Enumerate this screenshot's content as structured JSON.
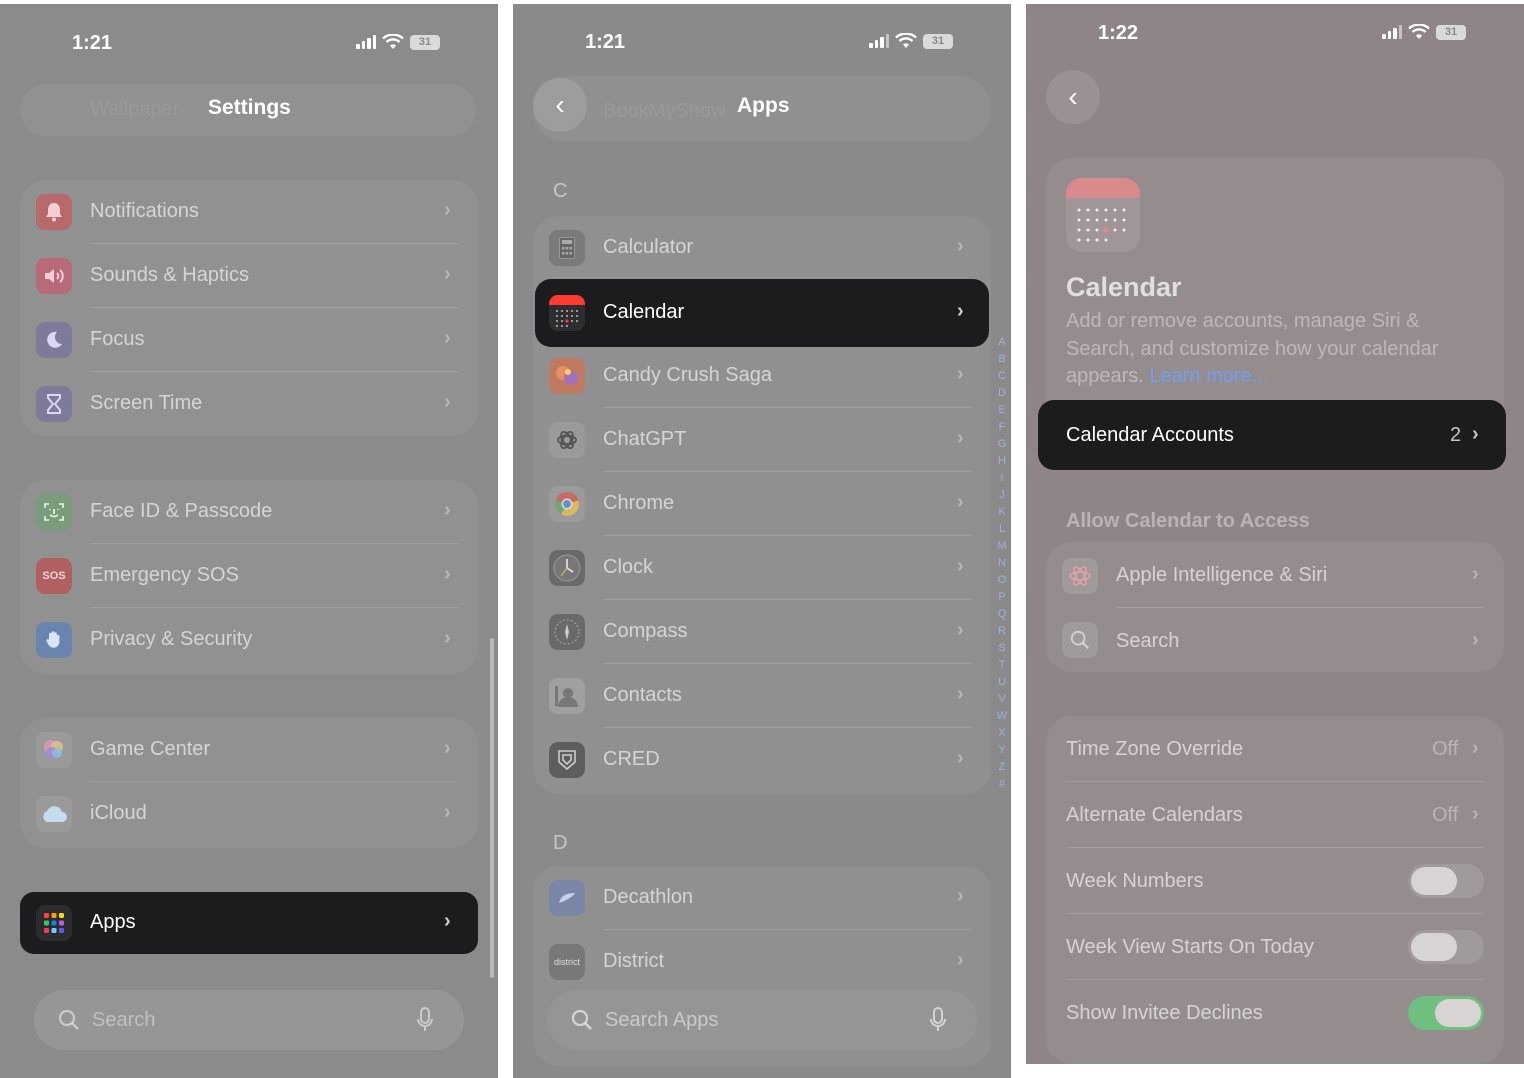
{
  "settings_panel": {
    "status": {
      "time": "1:21",
      "battery": "31"
    },
    "title": "Settings",
    "blurred_row_label": "Wallpaper",
    "group1": [
      {
        "label": "Notifications",
        "icon": "bell-icon"
      },
      {
        "label": "Sounds & Haptics",
        "icon": "speaker-icon"
      },
      {
        "label": "Focus",
        "icon": "moon-icon"
      },
      {
        "label": "Screen Time",
        "icon": "hourglass-icon"
      }
    ],
    "group2": [
      {
        "label": "Face ID & Passcode",
        "icon": "face-id-icon"
      },
      {
        "label": "Emergency SOS",
        "icon": "sos-icon",
        "icon_text": "SOS"
      },
      {
        "label": "Privacy & Security",
        "icon": "hand-icon"
      }
    ],
    "group3": [
      {
        "label": "Game Center",
        "icon": "game-center-icon"
      },
      {
        "label": "iCloud",
        "icon": "cloud-icon"
      }
    ],
    "apps_row": {
      "label": "Apps",
      "icon": "apps-grid-icon"
    },
    "search_placeholder": "Search"
  },
  "apps_panel": {
    "status": {
      "time": "1:21",
      "battery": "31"
    },
    "title": "Apps",
    "blurred_row_label": "BookMyShow",
    "section_c": "C",
    "section_d": "D",
    "c_apps": [
      {
        "label": "Calculator",
        "icon": "calculator-icon"
      },
      {
        "label": "Calendar",
        "icon": "calendar-icon"
      },
      {
        "label": "Candy Crush Saga",
        "icon": "candy-crush-icon"
      },
      {
        "label": "ChatGPT",
        "icon": "chatgpt-icon"
      },
      {
        "label": "Chrome",
        "icon": "chrome-icon"
      },
      {
        "label": "Clock",
        "icon": "clock-icon"
      },
      {
        "label": "Compass",
        "icon": "compass-icon"
      },
      {
        "label": "Contacts",
        "icon": "contacts-icon"
      },
      {
        "label": "CRED",
        "icon": "cred-icon"
      }
    ],
    "d_apps": [
      {
        "label": "Decathlon",
        "icon": "decathlon-icon"
      },
      {
        "label": "District",
        "icon": "district-icon",
        "icon_text": "district"
      }
    ],
    "index_letters": [
      "A",
      "B",
      "C",
      "D",
      "E",
      "F",
      "G",
      "H",
      "I",
      "J",
      "K",
      "L",
      "M",
      "N",
      "O",
      "P",
      "Q",
      "R",
      "S",
      "T",
      "U",
      "V",
      "W",
      "X",
      "Y",
      "Z",
      "#"
    ],
    "search_placeholder": "Search Apps"
  },
  "calendar_panel": {
    "status": {
      "time": "1:22",
      "battery": "31"
    },
    "app_name": "Calendar",
    "description": "Add or remove accounts, manage Siri & Search, and customize how your calendar appears.",
    "learn_more": "Learn more...",
    "accounts": {
      "label": "Calendar Accounts",
      "value": "2"
    },
    "access_header": "Allow Calendar to Access",
    "access_rows": [
      {
        "label": "Apple Intelligence & Siri",
        "icon": "apple-intelligence-icon"
      },
      {
        "label": "Search",
        "icon": "search-icon"
      }
    ],
    "settings_rows": [
      {
        "label": "Time Zone Override",
        "value": "Off"
      },
      {
        "label": "Alternate Calendars",
        "value": "Off"
      }
    ],
    "toggles": [
      {
        "label": "Week Numbers",
        "on": false
      },
      {
        "label": "Week View Starts On Today",
        "on": false
      },
      {
        "label": "Show Invitee Declines",
        "on": true
      }
    ]
  },
  "colors": {
    "highlight": "#1c1c1e",
    "link": "#6fa0f0",
    "toggle_on": "#6fbf80"
  }
}
